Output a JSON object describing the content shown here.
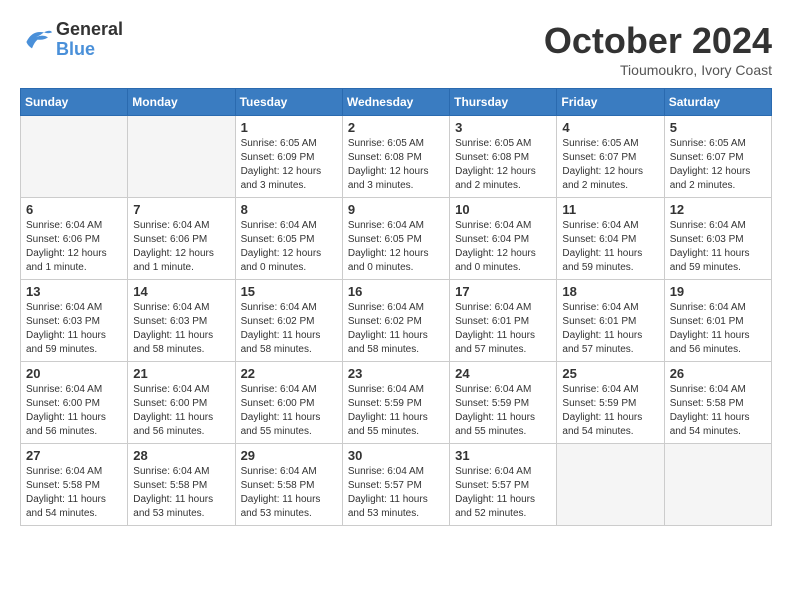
{
  "logo": {
    "line1": "General",
    "line2": "Blue"
  },
  "title": "October 2024",
  "location": "Tioumoukro, Ivory Coast",
  "weekdays": [
    "Sunday",
    "Monday",
    "Tuesday",
    "Wednesday",
    "Thursday",
    "Friday",
    "Saturday"
  ],
  "weeks": [
    [
      {
        "day": "",
        "info": ""
      },
      {
        "day": "",
        "info": ""
      },
      {
        "day": "1",
        "info": "Sunrise: 6:05 AM\nSunset: 6:09 PM\nDaylight: 12 hours\nand 3 minutes."
      },
      {
        "day": "2",
        "info": "Sunrise: 6:05 AM\nSunset: 6:08 PM\nDaylight: 12 hours\nand 3 minutes."
      },
      {
        "day": "3",
        "info": "Sunrise: 6:05 AM\nSunset: 6:08 PM\nDaylight: 12 hours\nand 2 minutes."
      },
      {
        "day": "4",
        "info": "Sunrise: 6:05 AM\nSunset: 6:07 PM\nDaylight: 12 hours\nand 2 minutes."
      },
      {
        "day": "5",
        "info": "Sunrise: 6:05 AM\nSunset: 6:07 PM\nDaylight: 12 hours\nand 2 minutes."
      }
    ],
    [
      {
        "day": "6",
        "info": "Sunrise: 6:04 AM\nSunset: 6:06 PM\nDaylight: 12 hours\nand 1 minute."
      },
      {
        "day": "7",
        "info": "Sunrise: 6:04 AM\nSunset: 6:06 PM\nDaylight: 12 hours\nand 1 minute."
      },
      {
        "day": "8",
        "info": "Sunrise: 6:04 AM\nSunset: 6:05 PM\nDaylight: 12 hours\nand 0 minutes."
      },
      {
        "day": "9",
        "info": "Sunrise: 6:04 AM\nSunset: 6:05 PM\nDaylight: 12 hours\nand 0 minutes."
      },
      {
        "day": "10",
        "info": "Sunrise: 6:04 AM\nSunset: 6:04 PM\nDaylight: 12 hours\nand 0 minutes."
      },
      {
        "day": "11",
        "info": "Sunrise: 6:04 AM\nSunset: 6:04 PM\nDaylight: 11 hours\nand 59 minutes."
      },
      {
        "day": "12",
        "info": "Sunrise: 6:04 AM\nSunset: 6:03 PM\nDaylight: 11 hours\nand 59 minutes."
      }
    ],
    [
      {
        "day": "13",
        "info": "Sunrise: 6:04 AM\nSunset: 6:03 PM\nDaylight: 11 hours\nand 59 minutes."
      },
      {
        "day": "14",
        "info": "Sunrise: 6:04 AM\nSunset: 6:03 PM\nDaylight: 11 hours\nand 58 minutes."
      },
      {
        "day": "15",
        "info": "Sunrise: 6:04 AM\nSunset: 6:02 PM\nDaylight: 11 hours\nand 58 minutes."
      },
      {
        "day": "16",
        "info": "Sunrise: 6:04 AM\nSunset: 6:02 PM\nDaylight: 11 hours\nand 58 minutes."
      },
      {
        "day": "17",
        "info": "Sunrise: 6:04 AM\nSunset: 6:01 PM\nDaylight: 11 hours\nand 57 minutes."
      },
      {
        "day": "18",
        "info": "Sunrise: 6:04 AM\nSunset: 6:01 PM\nDaylight: 11 hours\nand 57 minutes."
      },
      {
        "day": "19",
        "info": "Sunrise: 6:04 AM\nSunset: 6:01 PM\nDaylight: 11 hours\nand 56 minutes."
      }
    ],
    [
      {
        "day": "20",
        "info": "Sunrise: 6:04 AM\nSunset: 6:00 PM\nDaylight: 11 hours\nand 56 minutes."
      },
      {
        "day": "21",
        "info": "Sunrise: 6:04 AM\nSunset: 6:00 PM\nDaylight: 11 hours\nand 56 minutes."
      },
      {
        "day": "22",
        "info": "Sunrise: 6:04 AM\nSunset: 6:00 PM\nDaylight: 11 hours\nand 55 minutes."
      },
      {
        "day": "23",
        "info": "Sunrise: 6:04 AM\nSunset: 5:59 PM\nDaylight: 11 hours\nand 55 minutes."
      },
      {
        "day": "24",
        "info": "Sunrise: 6:04 AM\nSunset: 5:59 PM\nDaylight: 11 hours\nand 55 minutes."
      },
      {
        "day": "25",
        "info": "Sunrise: 6:04 AM\nSunset: 5:59 PM\nDaylight: 11 hours\nand 54 minutes."
      },
      {
        "day": "26",
        "info": "Sunrise: 6:04 AM\nSunset: 5:58 PM\nDaylight: 11 hours\nand 54 minutes."
      }
    ],
    [
      {
        "day": "27",
        "info": "Sunrise: 6:04 AM\nSunset: 5:58 PM\nDaylight: 11 hours\nand 54 minutes."
      },
      {
        "day": "28",
        "info": "Sunrise: 6:04 AM\nSunset: 5:58 PM\nDaylight: 11 hours\nand 53 minutes."
      },
      {
        "day": "29",
        "info": "Sunrise: 6:04 AM\nSunset: 5:58 PM\nDaylight: 11 hours\nand 53 minutes."
      },
      {
        "day": "30",
        "info": "Sunrise: 6:04 AM\nSunset: 5:57 PM\nDaylight: 11 hours\nand 53 minutes."
      },
      {
        "day": "31",
        "info": "Sunrise: 6:04 AM\nSunset: 5:57 PM\nDaylight: 11 hours\nand 52 minutes."
      },
      {
        "day": "",
        "info": ""
      },
      {
        "day": "",
        "info": ""
      }
    ]
  ]
}
